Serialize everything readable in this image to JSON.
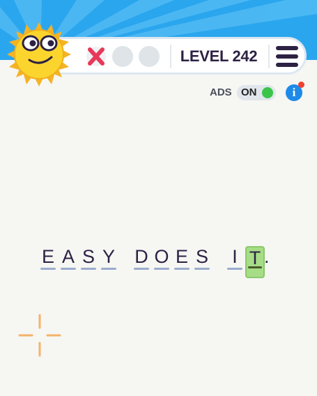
{
  "colors": {
    "sky": "#2aa6ee",
    "sky_ray": "#56bdf4",
    "text_dark": "#2d2144",
    "underline": "#9aaccd",
    "life_empty": "#dee4e8",
    "cross_red": "#e8385a",
    "ads_knob": "#3ac54a",
    "info_blue": "#1e8ae8",
    "notify_red": "#f0402e",
    "active_cell": "#a6dd86",
    "target_orange": "#f4b26a"
  },
  "header": {
    "mascot_icon": "sun-mascot-icon",
    "lives": {
      "lost": 1,
      "remaining": 2,
      "lost_icon": "cross-icon"
    },
    "level_label": "LEVEL 242",
    "menu_icon": "hamburger-menu-icon"
  },
  "ads": {
    "label": "ADS",
    "state": "ON",
    "info_icon": "info-icon",
    "info_glyph": "i",
    "has_notification": true
  },
  "puzzle": {
    "letters": [
      "E",
      "A",
      "S",
      "Y",
      "D",
      "O",
      "E",
      "S",
      "I",
      "T"
    ],
    "words": [
      "EASY",
      "DOES",
      "IT"
    ],
    "punctuation": ".",
    "active_cell_index": 9
  },
  "hint_icon": "crosshair-sparkle-icon"
}
